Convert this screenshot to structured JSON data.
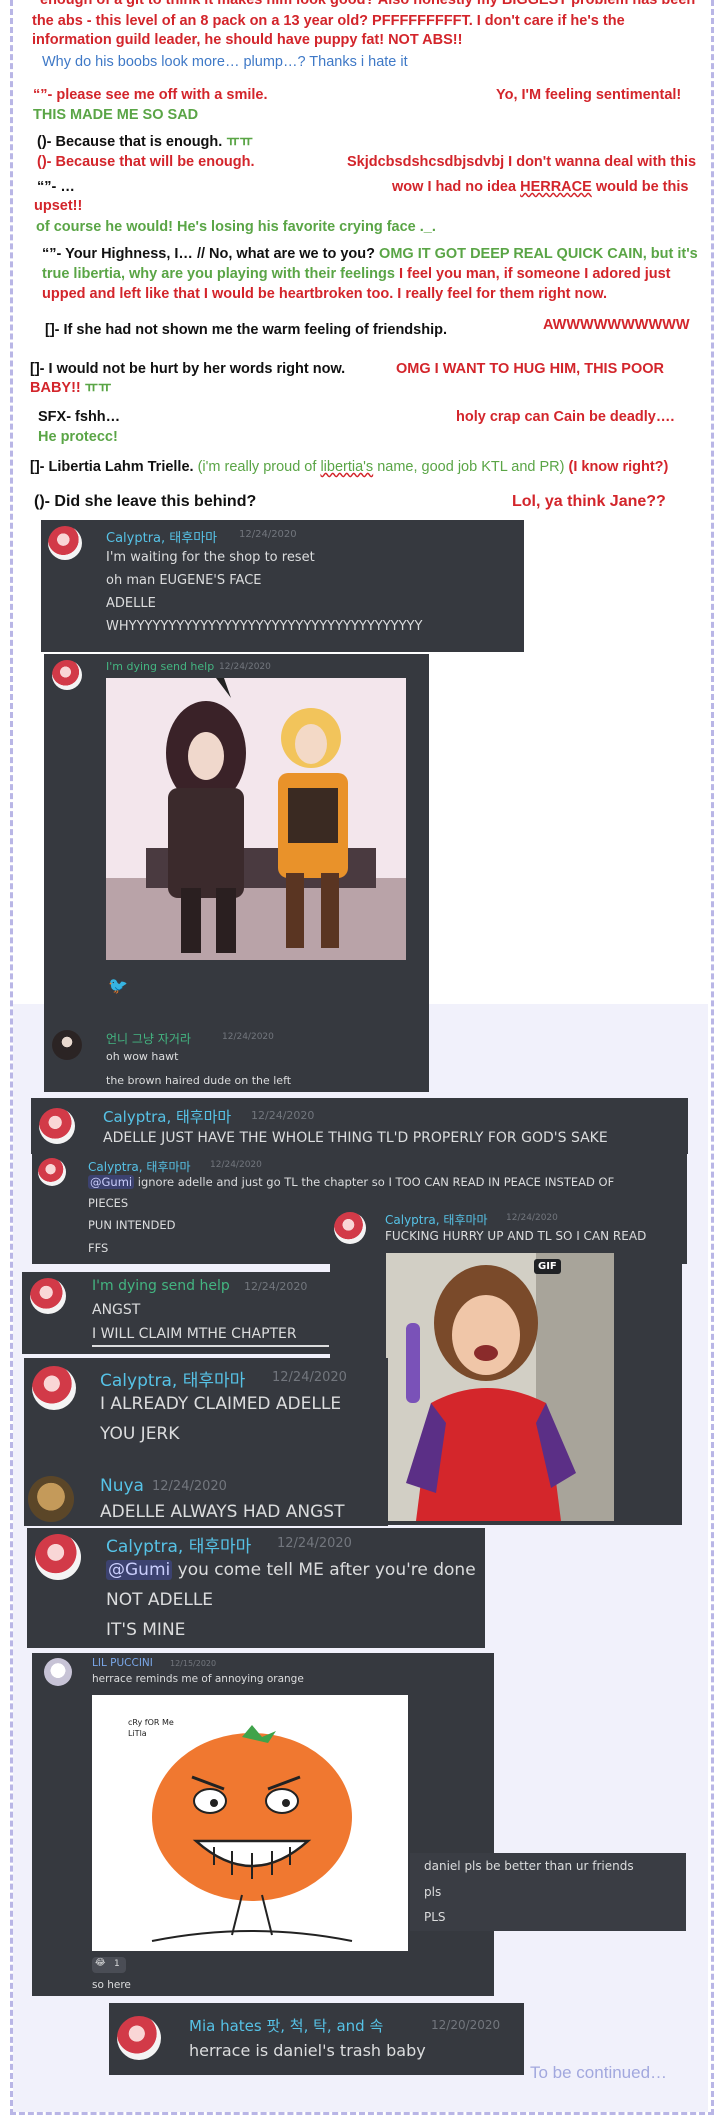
{
  "top": {
    "line1": "enough of a git to think it makes him look good? Also honestly my BIGGEST problem has been",
    "line2": "the abs - this level of an 8 pack on a 13 year old? PFFFFFFFFFT. I don't care if he's the",
    "line3": "information guild leader, he should have puppy fat! NOT ABS!!",
    "line4": "Why do his boobs look more… plump…? Thanks i hate it"
  },
  "notes": {
    "n1a": "“”- please see me off with a smile.",
    "n1b": "Yo, I'M feeling sentimental!",
    "n1c": "THIS MADE ME SO SAD",
    "n2a": "()- Because that is enough.",
    "n2b": "ㅠㅠ",
    "n3a": "()- Because that will be enough.",
    "n3b": "Skjdcbsdshcsdbjsdvbj I don't wanna deal with this",
    "n4a": "“”- …",
    "n4b_pre": "wow I had no idea ",
    "n4b_name": "HERRACE",
    "n4b_post": " would be this",
    "n4c": "upset!!",
    "n5": "of course he would! He's losing his favorite crying face ._.",
    "n6a": "“”- Your Highness, I… // No, what are we to you?",
    "n6b": "OMG IT GOT DEEP REAL QUICK CAIN, but it's",
    "n6c": "true libertia, why are you playing with their feelings",
    "n6d": "I feel you man, if someone I adored just",
    "n6e": "upped and left like that I would be heartbroken too. I really feel for them right now.",
    "n7a": "[]- If she had not shown me the warm feeling of friendship.",
    "n7b": "AWWWWWWWWWW",
    "n8a": "[]- I would not be hurt by her words right now.",
    "n8b": "OMG I WANT TO HUG HIM, THIS POOR",
    "n8c": "BABY!!",
    "n8d": "ㅠㅠ",
    "n9a": "SFX- fshh…",
    "n9b": "holy crap can Cain be deadly….",
    "n9c": "He protecc!",
    "n10a": "[]- Libertia Lahm Trielle.",
    "n10b_pre": "(i'm really proud of ",
    "n10b_name": "libertia's",
    "n10b_post": " name, good job KTL and PR)",
    "n10c": "(I know right?)",
    "n11a": "()- Did she leave this behind?",
    "n11b": "Lol, ya think Jane??"
  },
  "chat": {
    "m1": {
      "name": "Calyptra, 태후마마",
      "time": "12/24/2020",
      "lines": [
        "I'm waiting for the shop to reset",
        "oh man EUGENE'S FACE",
        "ADELLE",
        "WHYYYYYYYYYYYYYYYYYYYYYYYYYYYYYYYYYYYYY"
      ]
    },
    "m2": {
      "name": "I'm dying send help",
      "time": "12/24/2020",
      "reaction": "🐦"
    },
    "m3": {
      "name": "언니 그냥 자거라",
      "time": "12/24/2020",
      "lines": [
        "oh wow hawt",
        "the brown haired dude on the left"
      ]
    },
    "m4": {
      "name": "Calyptra, 태후마마",
      "time": "12/24/2020",
      "lines": [
        "ADELLE JUST HAVE THE WHOLE THING TL'D PROPERLY FOR GOD'S SAKE"
      ]
    },
    "m5": {
      "name": "Calyptra, 태후마마",
      "time": "12/24/2020",
      "mention": "@Gumi",
      "line1": " ignore adelle and just go TL the chapter so I TOO CAN READ IN PEACE INSTEAD OF",
      "line2": "PIECES",
      "line3": "PUN INTENDED",
      "line4": "FFS"
    },
    "m6": {
      "name": "Calyptra, 태후마마",
      "time": "12/24/2020",
      "lines": [
        "FUCKING HURRY UP AND TL SO I CAN READ"
      ],
      "gif": "GIF"
    },
    "m7": {
      "name": "I'm dying send help",
      "time": "12/24/2020",
      "lines": [
        "ANGST",
        "I WILL CLAIM MTHE CHAPTER"
      ]
    },
    "m8": {
      "name": "Calyptra, 태후마마",
      "time": "12/24/2020",
      "lines": [
        "I ALREADY CLAIMED ADELLE",
        "YOU JERK"
      ]
    },
    "m9": {
      "name": "Nuya",
      "time": "12/24/2020",
      "lines": [
        "ADELLE ALWAYS HAD ANGST"
      ]
    },
    "m10": {
      "name": "Calyptra, 태후마마",
      "time": "12/24/2020",
      "mention": "@Gumi",
      "line1": " you come tell ME after you're done",
      "line2": "NOT ADELLE",
      "line3": "IT'S MINE"
    },
    "m11": {
      "name": "LIL PUCCINI",
      "time": "12/15/2020",
      "text": "herrace reminds me of annoying orange",
      "drawing_caption": "cRy fOR Me\nLiTla",
      "reaction_count": "1",
      "footer": "so here"
    },
    "m12": {
      "lines": [
        "daniel pls be better  than ur friends",
        "pls",
        "PLS"
      ]
    },
    "m13": {
      "name": "Mia hates 팟, 척, 탁, and 속",
      "time": "12/20/2020",
      "text": "herrace is daniel's trash  baby"
    }
  },
  "footer": {
    "continued": "To be continued…"
  }
}
